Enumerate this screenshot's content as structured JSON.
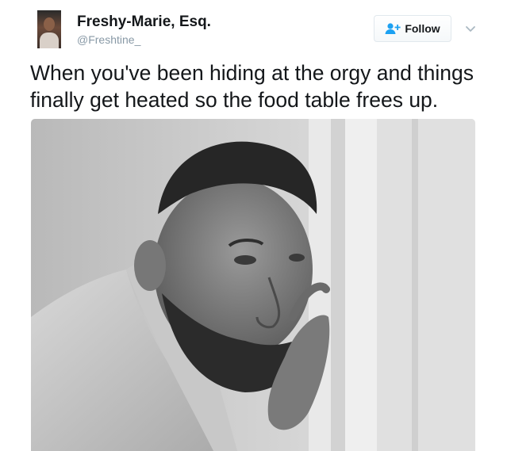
{
  "author": {
    "display_name": "Freshy-Marie, Esq.",
    "handle": "@Freshtine_",
    "avatar_icon": "profile-photo"
  },
  "follow_button": {
    "label": "Follow",
    "icon": "add-user-icon",
    "accent": "#1da1f2"
  },
  "menu": {
    "icon": "chevron-down-icon"
  },
  "tweet": {
    "text": "When you've been hiding at the orgy and things finally get heated so the food table frees up."
  },
  "media": {
    "type": "photo",
    "style": "black-and-white"
  },
  "colors": {
    "text": "#14171a",
    "muted": "#8899a6",
    "border": "#e1e8ed",
    "accent": "#1da1f2"
  }
}
